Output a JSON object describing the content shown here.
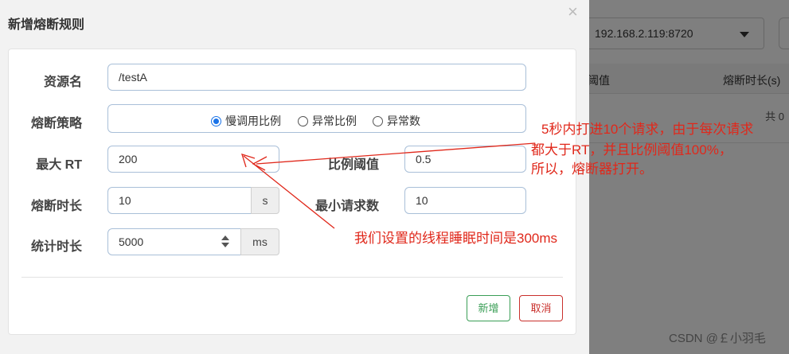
{
  "background": {
    "ip_select": "192.168.2.119:8720",
    "table_headers": [
      "阈值",
      "熔断时长(s)"
    ],
    "total_text": "共 0"
  },
  "modal": {
    "title": "新增熔断规则",
    "close_glyph": "×",
    "fields": {
      "resource_label": "资源名",
      "resource_value": "/testA",
      "strategy_label": "熔断策略",
      "strategy_options": [
        "慢调用比例",
        "异常比例",
        "异常数"
      ],
      "strategy_selected": "慢调用比例",
      "max_rt_label": "最大 RT",
      "max_rt_value": "200",
      "ratio_label": "比例阈值",
      "ratio_value": "0.5",
      "duration_label": "熔断时长",
      "duration_value": "10",
      "duration_unit": "s",
      "min_request_label": "最小请求数",
      "min_request_value": "10",
      "stat_label": "统计时长",
      "stat_value": "5000",
      "stat_unit": "ms"
    },
    "buttons": {
      "add": "新增",
      "cancel": "取消"
    }
  },
  "annotations": {
    "note1": [
      "5秒内打进10个请求，由于每次请求",
      "都大于RT，并且比例阈值100%，",
      "所以，熔断器打开。"
    ],
    "note2": "我们设置的线程睡眠时间是300ms",
    "color": "#e0281b"
  },
  "watermark": "CSDN @￡小羽毛"
}
